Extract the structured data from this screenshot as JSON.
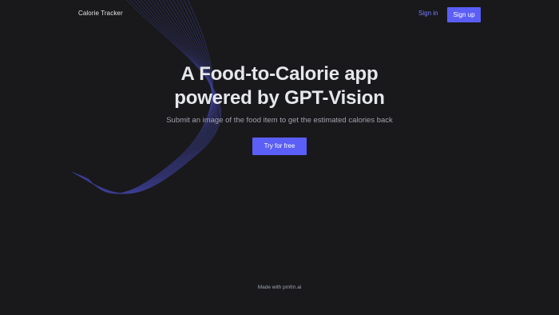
{
  "header": {
    "brand": "Calorie Tracker",
    "sign_in_label": "Sign in",
    "sign_up_label": "Sign up"
  },
  "hero": {
    "title_line1": "A Food-to-Calorie app",
    "title_line2": "powered by GPT-Vision",
    "subtitle": "Submit an image of the food item to get the estimated calories back",
    "cta_label": "Try for free"
  },
  "footer": {
    "text": "Made with pmfm.ai"
  },
  "colors": {
    "background": "#19191c",
    "accent": "#5b5ef7",
    "link": "#7c7cff",
    "wave": "#5b5ef7"
  }
}
